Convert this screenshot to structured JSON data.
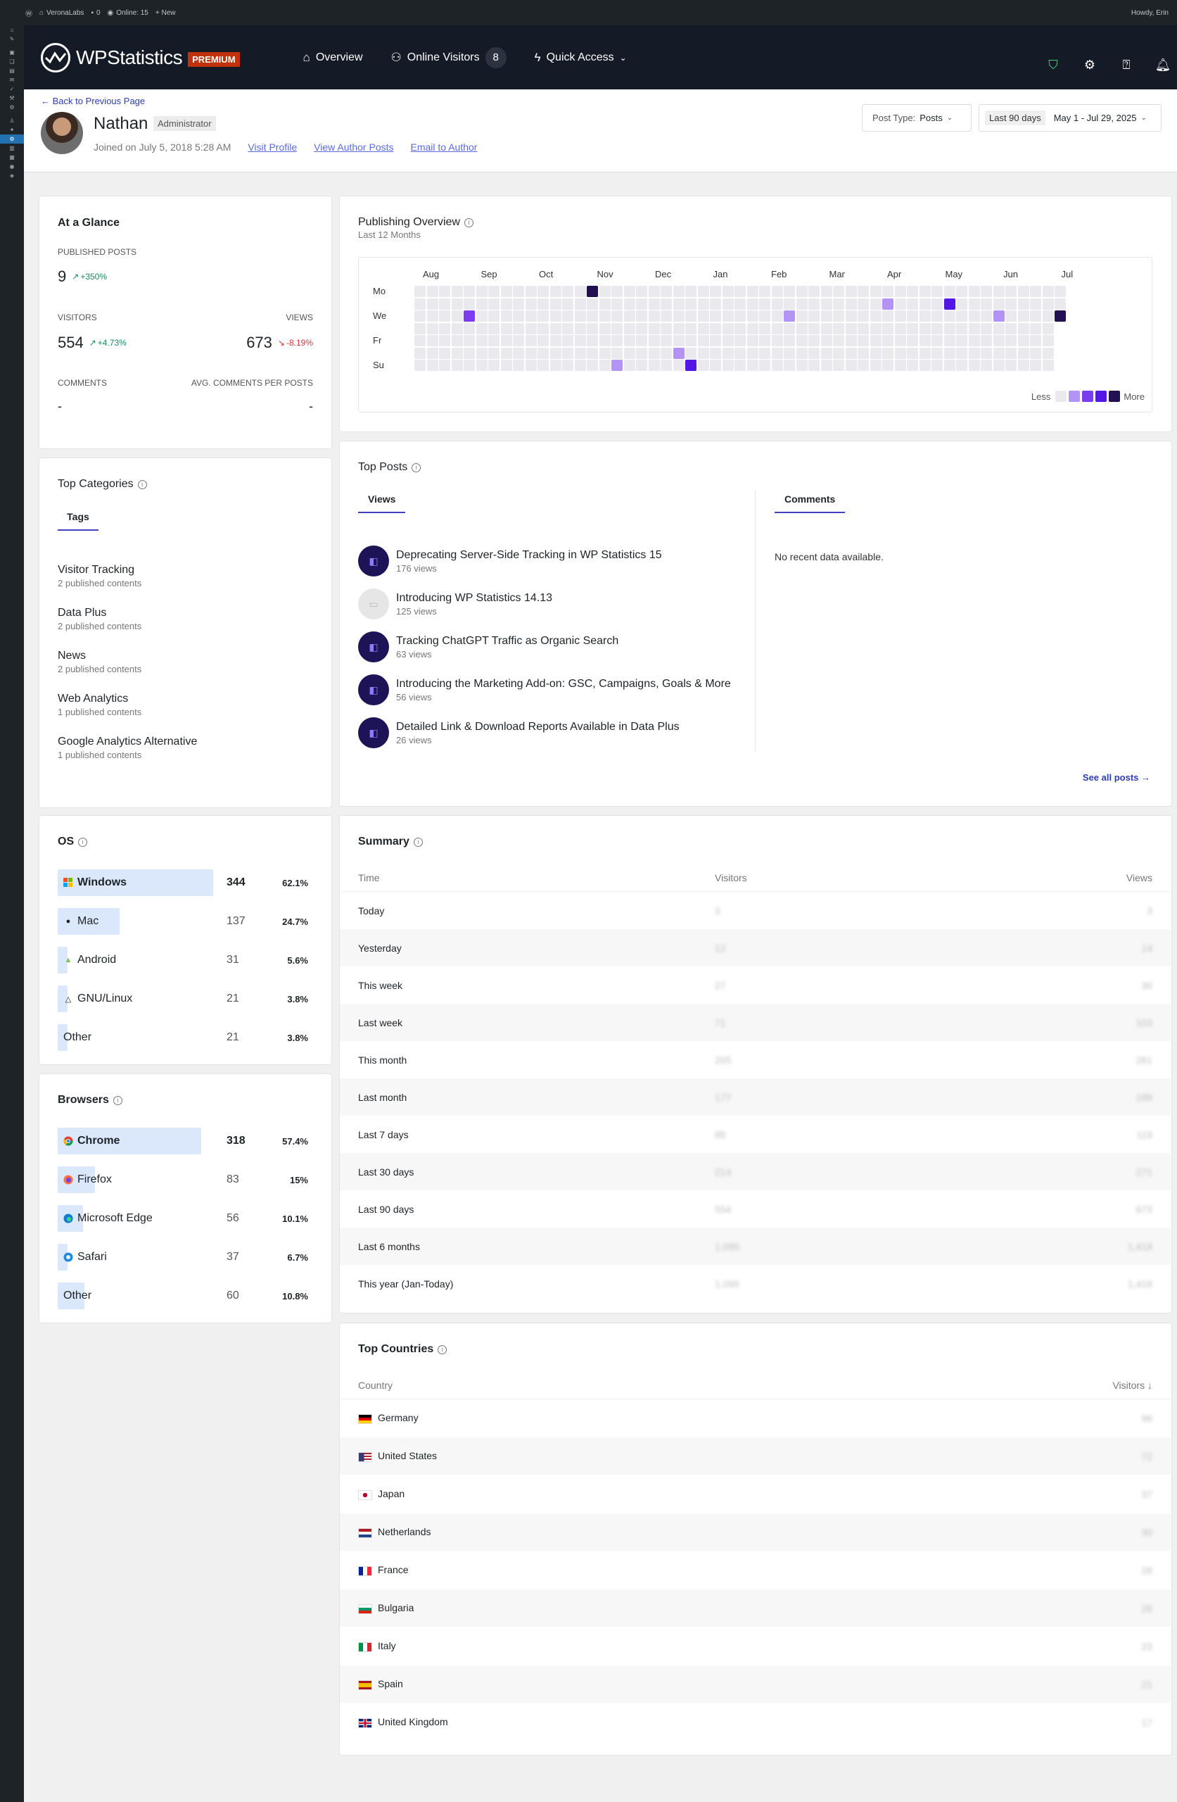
{
  "admin_bar": {
    "site": "VeronaLabs",
    "comments": "0",
    "online": "Online: 15",
    "new": "+ New",
    "howdy": "Howdy, Erin"
  },
  "header": {
    "brand": "WPStatistics",
    "badge": "PREMIUM",
    "nav": [
      {
        "label": "Overview",
        "icon": "home-icon"
      },
      {
        "label": "Online Visitors",
        "icon": "users-icon",
        "count": "8"
      },
      {
        "label": "Quick Access",
        "icon": "lightning-icon"
      }
    ]
  },
  "author": {
    "back": "← Back to Previous Page",
    "name": "Nathan",
    "role": "Administrator",
    "joined": "Joined on July 5, 2018 5:28 AM",
    "links": [
      "Visit Profile",
      "View Author Posts",
      "Email to Author"
    ],
    "post_type_label": "Post Type:",
    "post_type_value": "Posts",
    "range_pill": "Last 90 days",
    "range_value": "May 1 - Jul 29, 2025"
  },
  "glance": {
    "title": "At a Glance",
    "published_label": "PUBLISHED POSTS",
    "published_value": "9",
    "published_change": "+350%",
    "visitors_label": "VISITORS",
    "visitors_value": "554",
    "visitors_change": "+4.73%",
    "views_label": "VIEWS",
    "views_value": "673",
    "views_change": "-8.19%",
    "comments_label": "COMMENTS",
    "comments_value": "-",
    "avg_label": "AVG. COMMENTS PER POSTS",
    "avg_value": "-"
  },
  "publishing": {
    "title": "Publishing Overview",
    "subtitle": "Last 12 Months",
    "months": [
      "Aug",
      "Sep",
      "Oct",
      "Nov",
      "Dec",
      "Jan",
      "Feb",
      "Mar",
      "Apr",
      "May",
      "Jun",
      "Jul"
    ],
    "days": [
      "Mo",
      "We",
      "Fr",
      "Su"
    ],
    "legend_less": "Less",
    "legend_more": "More",
    "colors": [
      "#e9e9ee",
      "#b394f5",
      "#7a3df0",
      "#5216e6",
      "#221052"
    ],
    "weeks": 53,
    "active": [
      {
        "week": 14,
        "day": 0,
        "level": 4
      },
      {
        "week": 4,
        "day": 2,
        "level": 2
      },
      {
        "week": 30,
        "day": 2,
        "level": 1
      },
      {
        "week": 38,
        "day": 1,
        "level": 1
      },
      {
        "week": 43,
        "day": 1,
        "level": 3
      },
      {
        "week": 47,
        "day": 2,
        "level": 1
      },
      {
        "week": 52,
        "day": 2,
        "level": 4
      },
      {
        "week": 21,
        "day": 5,
        "level": 1
      },
      {
        "week": 16,
        "day": 6,
        "level": 1
      },
      {
        "week": 22,
        "day": 6,
        "level": 3
      }
    ]
  },
  "categories": {
    "title": "Top Categories",
    "tab": "Tags",
    "items": [
      {
        "name": "Visitor Tracking",
        "count": "2 published contents"
      },
      {
        "name": "Data Plus",
        "count": "2 published contents"
      },
      {
        "name": "News",
        "count": "2 published contents"
      },
      {
        "name": "Web Analytics",
        "count": "1 published contents"
      },
      {
        "name": "Google Analytics Alternative",
        "count": "1 published contents"
      }
    ]
  },
  "top_posts": {
    "title": "Top Posts",
    "tab_views": "Views",
    "tab_comments": "Comments",
    "no_data": "No recent data available.",
    "see_all": "See all posts →",
    "items": [
      {
        "title": "Deprecating Server-Side Tracking in WP Statistics 15",
        "views": "176 views"
      },
      {
        "title": "Introducing WP Statistics 14.13",
        "views": "125 views"
      },
      {
        "title": "Tracking ChatGPT Traffic as Organic Search",
        "views": "63 views"
      },
      {
        "title": "Introducing the Marketing Add-on: GSC, Campaigns, Goals & More",
        "views": "56 views"
      },
      {
        "title": "Detailed Link & Download Reports Available in Data Plus",
        "views": "26 views"
      }
    ]
  },
  "os": {
    "title": "OS",
    "items": [
      {
        "name": "Windows",
        "count": "344",
        "pct": "62.1%",
        "share": 0.621,
        "icon": "windows-icon"
      },
      {
        "name": "Mac",
        "count": "137",
        "pct": "24.7%",
        "share": 0.247,
        "icon": "apple-icon"
      },
      {
        "name": "Android",
        "count": "31",
        "pct": "5.6%",
        "share": 0.056,
        "icon": "android-icon"
      },
      {
        "name": "GNU/Linux",
        "count": "21",
        "pct": "3.8%",
        "share": 0.038,
        "icon": "linux-icon"
      },
      {
        "name": "Other",
        "count": "21",
        "pct": "3.8%",
        "share": 0.038,
        "icon": ""
      }
    ]
  },
  "browsers": {
    "title": "Browsers",
    "items": [
      {
        "name": "Chrome",
        "count": "318",
        "pct": "57.4%",
        "share": 0.574,
        "icon": "chrome-icon"
      },
      {
        "name": "Firefox",
        "count": "83",
        "pct": "15%",
        "share": 0.15,
        "icon": "firefox-icon"
      },
      {
        "name": "Microsoft Edge",
        "count": "56",
        "pct": "10.1%",
        "share": 0.101,
        "icon": "edge-icon"
      },
      {
        "name": "Safari",
        "count": "37",
        "pct": "6.7%",
        "share": 0.067,
        "icon": "safari-icon"
      },
      {
        "name": "Other",
        "count": "60",
        "pct": "10.8%",
        "share": 0.108,
        "icon": ""
      }
    ]
  },
  "summary": {
    "title": "Summary",
    "col_time": "Time",
    "col_visitors": "Visitors",
    "col_views": "Views",
    "rows": [
      {
        "time": "Today",
        "visitors": "3",
        "views": "3"
      },
      {
        "time": "Yesterday",
        "visitors": "12",
        "views": "14"
      },
      {
        "time": "This week",
        "visitors": "27",
        "views": "30"
      },
      {
        "time": "Last week",
        "visitors": "71",
        "views": "103"
      },
      {
        "time": "This month",
        "visitors": "205",
        "views": "261"
      },
      {
        "time": "Last month",
        "visitors": "177",
        "views": "188"
      },
      {
        "time": "Last 7 days",
        "visitors": "85",
        "views": "119"
      },
      {
        "time": "Last 30 days",
        "visitors": "214",
        "views": "271"
      },
      {
        "time": "Last 90 days",
        "visitors": "554",
        "views": "673"
      },
      {
        "time": "Last 6 months",
        "visitors": "1,095",
        "views": "1,418"
      },
      {
        "time": "This year (Jan-Today)",
        "visitors": "1,095",
        "views": "1,418"
      }
    ]
  },
  "countries": {
    "title": "Top Countries",
    "col_country": "Country",
    "col_visitors": "Visitors ↓",
    "rows": [
      {
        "name": "Germany",
        "visitors": "96",
        "flag": [
          "#000000",
          "#dd0000",
          "#ffce00"
        ],
        "dir": "h"
      },
      {
        "name": "United States",
        "visitors": "72",
        "flag": [
          "#b22234",
          "#ffffff",
          "#3c3b6e"
        ],
        "dir": "us"
      },
      {
        "name": "Japan",
        "visitors": "37",
        "flag": [
          "#ffffff",
          "#bc002d"
        ],
        "dir": "jp"
      },
      {
        "name": "Netherlands",
        "visitors": "30",
        "flag": [
          "#ae1c28",
          "#ffffff",
          "#21468b"
        ],
        "dir": "h"
      },
      {
        "name": "France",
        "visitors": "28",
        "flag": [
          "#002395",
          "#ffffff",
          "#ed2939"
        ],
        "dir": "v"
      },
      {
        "name": "Bulgaria",
        "visitors": "26",
        "flag": [
          "#ffffff",
          "#00966e",
          "#d62612"
        ],
        "dir": "h"
      },
      {
        "name": "Italy",
        "visitors": "23",
        "flag": [
          "#009246",
          "#ffffff",
          "#ce2b37"
        ],
        "dir": "v"
      },
      {
        "name": "Spain",
        "visitors": "21",
        "flag": [
          "#aa151b",
          "#f1bf00",
          "#aa151b"
        ],
        "dir": "es"
      },
      {
        "name": "United Kingdom",
        "visitors": "17",
        "flag": [
          "#012169",
          "#ffffff",
          "#c8102e"
        ],
        "dir": "uk"
      }
    ]
  }
}
